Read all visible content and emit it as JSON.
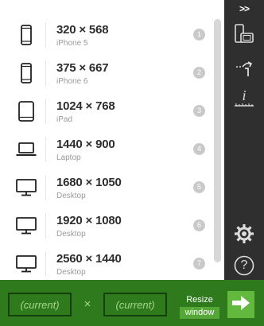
{
  "toolbar": {
    "collapse_label": ">>",
    "buttons": [
      {
        "icon": "rotate-device-icon"
      },
      {
        "icon": "swap-dimensions-icon"
      },
      {
        "icon": "info-ruler-icon"
      },
      {
        "icon": "settings-gear-icon"
      },
      {
        "icon": "help-question-icon",
        "label": "?"
      }
    ]
  },
  "devices": [
    {
      "resolution": "320 × 568",
      "name": "iPhone 5",
      "shortcut": "1",
      "icon": "phone-icon"
    },
    {
      "resolution": "375 × 667",
      "name": "iPhone 6",
      "shortcut": "2",
      "icon": "phone-icon"
    },
    {
      "resolution": "1024 × 768",
      "name": "iPad",
      "shortcut": "3",
      "icon": "tablet-icon"
    },
    {
      "resolution": "1440 × 900",
      "name": "Laptop",
      "shortcut": "4",
      "icon": "laptop-icon"
    },
    {
      "resolution": "1680 × 1050",
      "name": "Desktop",
      "shortcut": "5",
      "icon": "desktop-icon"
    },
    {
      "resolution": "1920 × 1080",
      "name": "Desktop",
      "shortcut": "6",
      "icon": "desktop-icon"
    },
    {
      "resolution": "2560 × 1440",
      "name": "Desktop",
      "shortcut": "7",
      "icon": "desktop-icon"
    }
  ],
  "custom_size": {
    "width_placeholder": "(current)",
    "height_placeholder": "(current)",
    "separator": "×",
    "resize_label_top": "Resize",
    "resize_label_bottom": "window"
  },
  "colors": {
    "toolbar_bg": "#2f2f2f",
    "bottom_bar_bg": "#2e7a1d",
    "go_button_bg": "#63b83e",
    "badge_bg": "#c9c9c9"
  }
}
